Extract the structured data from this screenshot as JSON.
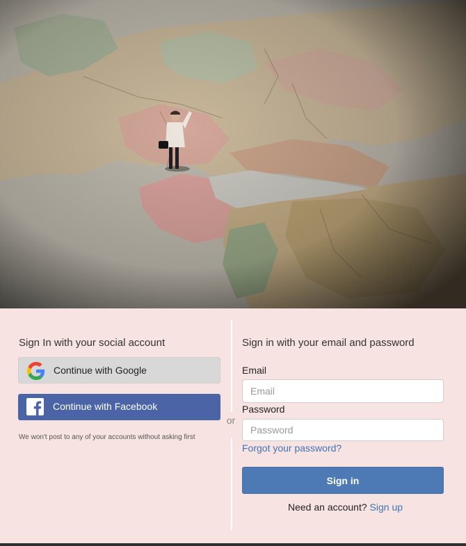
{
  "hero": {
    "image": "map-photo-with-miniature-businessman"
  },
  "social": {
    "heading": "Sign In with your social account",
    "google_label": "Continue with Google",
    "google_icon": "google-g-icon",
    "facebook_label": "Continue with Facebook",
    "facebook_icon": "facebook-f-icon",
    "disclaimer": "We won't post to any of your accounts without asking first"
  },
  "divider": {
    "or_text": "or"
  },
  "email_form": {
    "heading": "Sign in with your email and password",
    "email_label": "Email",
    "email_placeholder": "Email",
    "email_value": "",
    "password_label": "Password",
    "password_placeholder": "Password",
    "password_value": "",
    "forgot_link": "Forgot your password?",
    "signin_button": "Sign in",
    "need_account": "Need an account?",
    "signup_link": "Sign up"
  },
  "colors": {
    "panel_bg": "#f7e3e1",
    "google_btn": "#d8d8d8",
    "facebook_btn": "#4a64a6",
    "signin_btn": "#4d7ab5",
    "link": "#3f74b3"
  }
}
